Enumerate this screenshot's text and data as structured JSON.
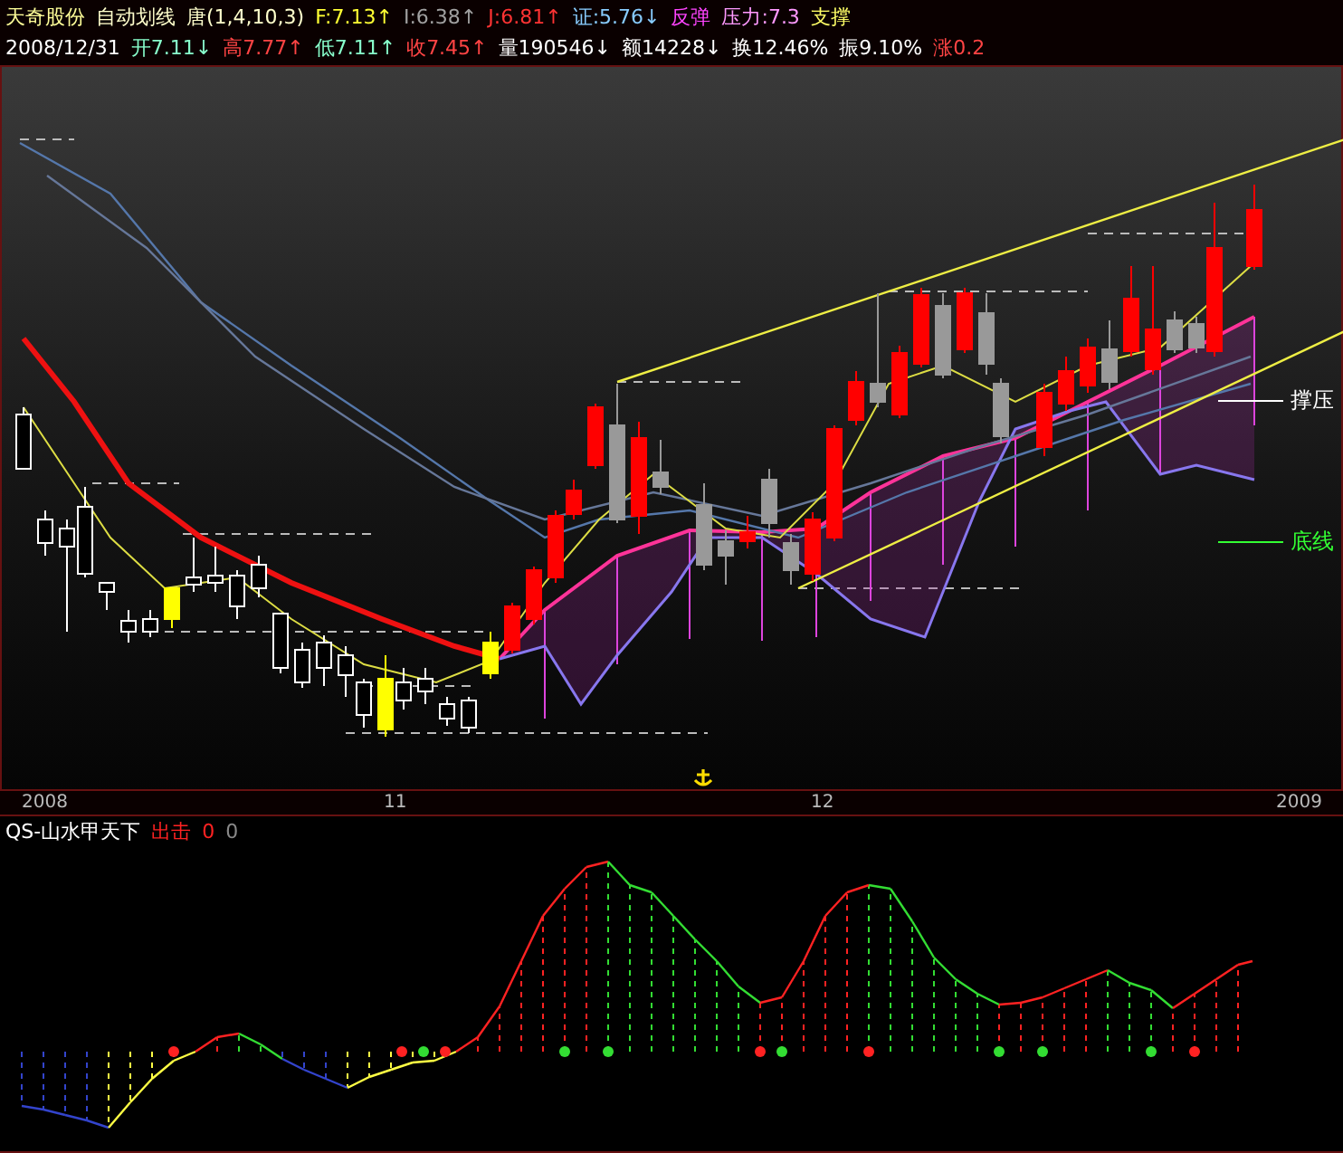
{
  "header": {
    "line_1": [
      {
        "text": "天奇股份",
        "color": "#ffff99"
      },
      {
        "text": "自动划线",
        "color": "#ffffcc"
      },
      {
        "text": "唐(1,4,10,3)",
        "color": "#ffffcc"
      },
      {
        "text": "F:7.13↑",
        "color": "#ffff33"
      },
      {
        "text": "I:6.38↑",
        "color": "#a0a0a0"
      },
      {
        "text": "J:6.81↑",
        "color": "#ff3333"
      },
      {
        "text": "证:5.76↓",
        "color": "#88ccff"
      },
      {
        "text": "反弹",
        "color": "#ff44ff"
      },
      {
        "text": "压力:7.3",
        "color": "#ff99ff"
      },
      {
        "text": "支撑",
        "color": "#ffff66"
      }
    ],
    "line_2": [
      {
        "text": "2008/12/31",
        "color": "#ffffff"
      },
      {
        "text": "开7.11↓",
        "color": "#88ffcc"
      },
      {
        "text": "高7.77↑",
        "color": "#ff4444"
      },
      {
        "text": "低7.11↑",
        "color": "#88ffcc"
      },
      {
        "text": "收7.45↑",
        "color": "#ff4444"
      },
      {
        "text": "量190546↓",
        "color": "#ffffff"
      },
      {
        "text": "额14228↓",
        "color": "#ffffff"
      },
      {
        "text": "换12.46%",
        "color": "#ffffff"
      },
      {
        "text": "振9.10%",
        "color": "#ffffff"
      },
      {
        "text": "涨0.2",
        "color": "#ff4444"
      }
    ]
  },
  "main_chart": {
    "labels": [
      {
        "text": "撑压",
        "color": "#ffffff"
      },
      {
        "text": "底线",
        "color": "#33ff33"
      }
    ]
  },
  "time_axis": [
    "2008",
    "11",
    "12",
    "2009"
  ],
  "indicator": {
    "name": "QS-山水甲天下",
    "signal_label": "出击",
    "values": [
      {
        "text": "0",
        "color": "#ff2222"
      },
      {
        "text": "0",
        "color": "#888888"
      }
    ]
  }
}
